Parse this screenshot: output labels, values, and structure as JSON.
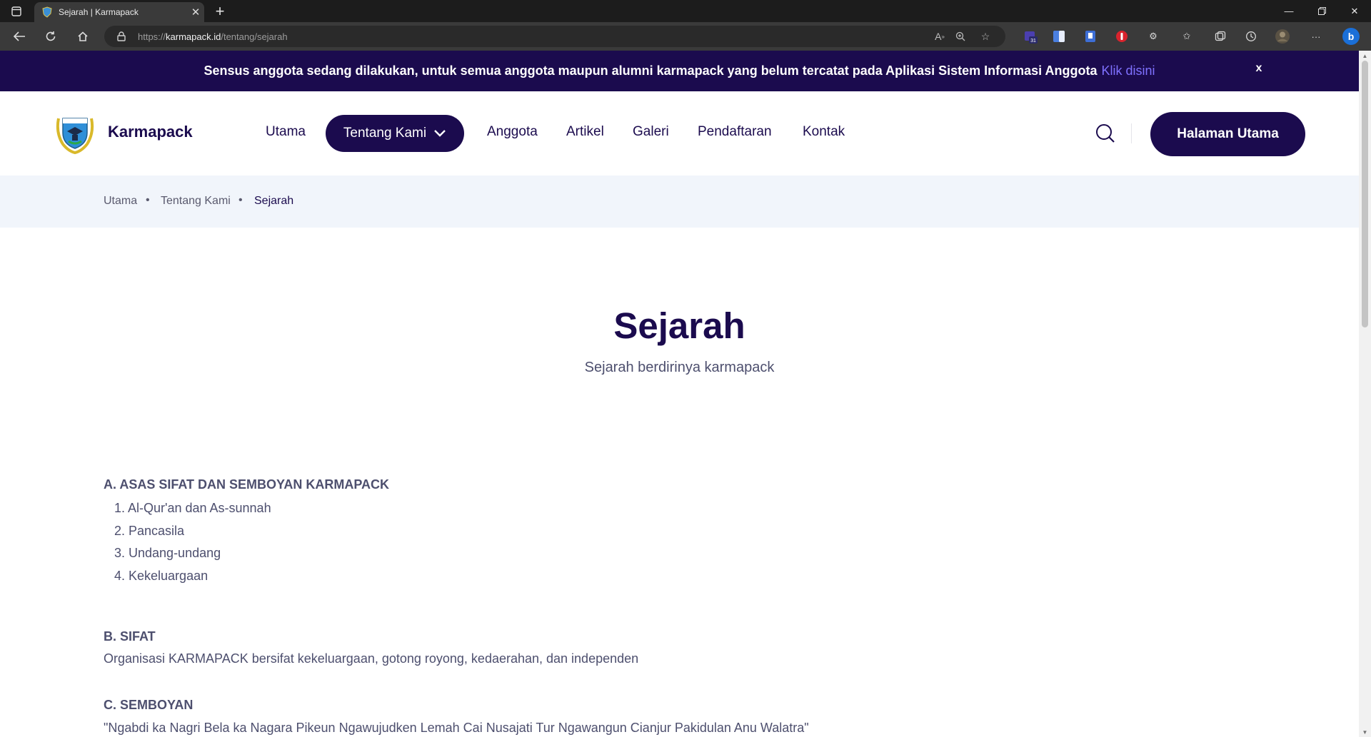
{
  "browser": {
    "tab_title": "Sejarah | Karmapack",
    "url_prefix": "https://",
    "url_domain": "karmapack.id",
    "url_path": "/tentang/sejarah",
    "calendar_badge": "31"
  },
  "announcement": {
    "text": "Sensus anggota sedang dilakukan, untuk semua anggota maupun alumni karmapack yang belum tercatat pada Aplikasi Sistem Informasi Anggota",
    "link_label": "Klik disini",
    "close_label": "x"
  },
  "header": {
    "brand": "Karmapack",
    "nav": [
      "Utama",
      "Tentang Kami",
      "Anggota",
      "Artikel",
      "Galeri",
      "Pendaftaran",
      "Kontak"
    ],
    "cta_label": "Halaman Utama"
  },
  "breadcrumb": [
    "Utama",
    "Tentang Kami",
    "Sejarah"
  ],
  "hero": {
    "title": "Sejarah",
    "subtitle": "Sejarah berdirinya karmapack"
  },
  "content": {
    "section_a": {
      "heading": "A. ASAS SIFAT DAN SEMBOYAN KARMAPACK",
      "items": [
        "1. Al-Qur'an dan As-sunnah",
        "2. Pancasila",
        "3. Undang-undang",
        "4. Kekeluargaan"
      ]
    },
    "section_b": {
      "heading": "B. SIFAT",
      "text": "Organisasi KARMAPACK bersifat kekeluargaan, gotong royong, kedaerahan, dan independen"
    },
    "section_c": {
      "heading": "C. SEMBOYAN",
      "text": "\"Ngabdi ka Nagri Bela ka Nagara Pikeun Ngawujudken Lemah Cai Nusajati Tur Ngawangun Cianjur Pakidulan Anu Walatra\""
    }
  },
  "colors": {
    "brand_dark": "#1b0b4e",
    "link_accent": "#7f71ff",
    "breadcrumb_bg": "#f1f5fb",
    "body_text": "#4d4f6e"
  }
}
